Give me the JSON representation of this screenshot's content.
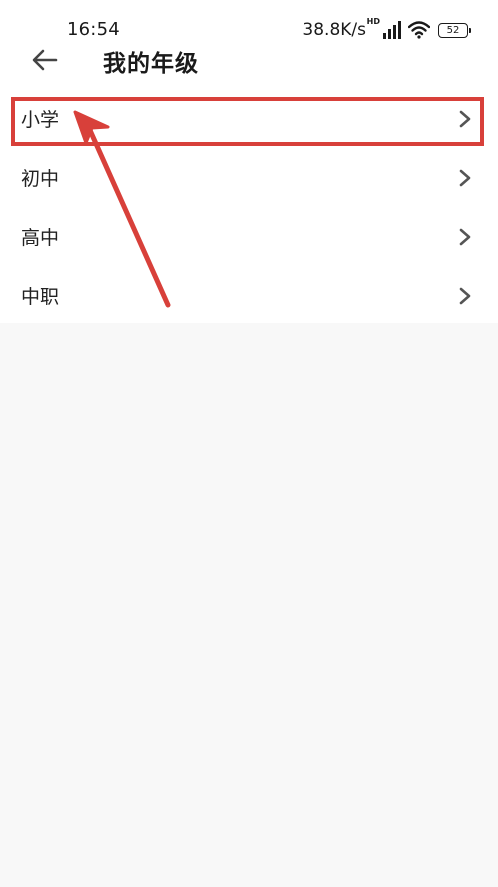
{
  "status_bar": {
    "time": "16:54",
    "net_speed": "38.8K/s",
    "hd_mark": "HD",
    "battery": "52"
  },
  "header": {
    "title": "我的年级"
  },
  "grades": [
    {
      "label": "小学"
    },
    {
      "label": "初中"
    },
    {
      "label": "高中"
    },
    {
      "label": "中职"
    }
  ],
  "colors": {
    "annotation_red": "#d8403a",
    "background": "#f8f8f8",
    "surface": "#ffffff",
    "text": "#222222",
    "chevron": "#555555"
  },
  "icons": {
    "back": "back-arrow-icon",
    "chevron": "chevron-right-icon",
    "signal": "signal-icon",
    "wifi": "wifi-icon",
    "battery": "battery-icon"
  }
}
